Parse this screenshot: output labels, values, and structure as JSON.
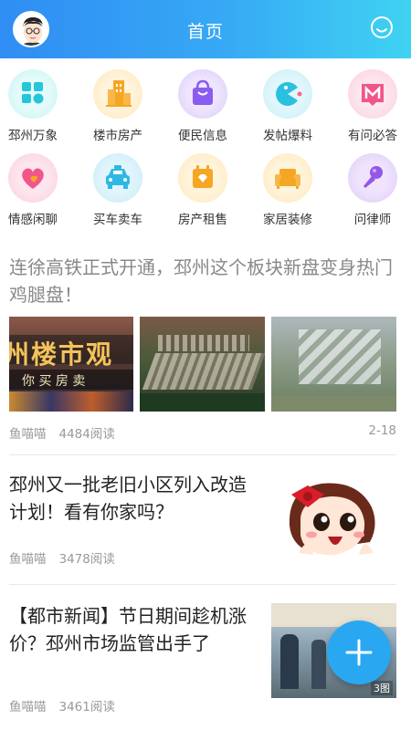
{
  "header": {
    "title": "首页",
    "avatar_icon": "avatar-icon",
    "search_icon": "search-icon"
  },
  "categories": [
    {
      "label": "邳州万象",
      "icon": "grid-apps-icon",
      "color": "#28d3d8"
    },
    {
      "label": "楼市房产",
      "icon": "building-icon",
      "color": "#f5a623"
    },
    {
      "label": "便民信息",
      "icon": "shopping-bag-icon",
      "color": "#8a5cf0"
    },
    {
      "label": "发帖爆料",
      "icon": "pacman-icon",
      "color": "#2cc0e0"
    },
    {
      "label": "有问必答",
      "icon": "chat-m-icon",
      "color": "#f2558a"
    },
    {
      "label": "情感闲聊",
      "icon": "heart-icon",
      "color": "#f2558a"
    },
    {
      "label": "买车卖车",
      "icon": "car-icon",
      "color": "#2fb8e6"
    },
    {
      "label": "房产租售",
      "icon": "calendar-diamond-icon",
      "color": "#f5a623"
    },
    {
      "label": "家居装修",
      "icon": "sofa-icon",
      "color": "#f5a623"
    },
    {
      "label": "问律师",
      "icon": "microphone-icon",
      "color": "#9457e6"
    }
  ],
  "articles": [
    {
      "title": "连徐高铁正式开通，邳州这个板块新盘变身热门鸡腿盘！",
      "author": "鱼喵喵",
      "reads": "4484阅读",
      "date": "2-18",
      "image_text_1": "州楼市观",
      "image_text_2": "你 买 房 卖"
    },
    {
      "title": "邳州又一批老旧小区列入改造计划！看有你家吗？",
      "author": "鱼喵喵",
      "reads": "3478阅读"
    },
    {
      "title": "【都市新闻】节日期间趁机涨价？邳州市场监管出手了",
      "author": "鱼喵喵",
      "reads": "3461阅读",
      "image_badge": "3图"
    }
  ],
  "fab": {
    "icon": "plus-icon"
  }
}
